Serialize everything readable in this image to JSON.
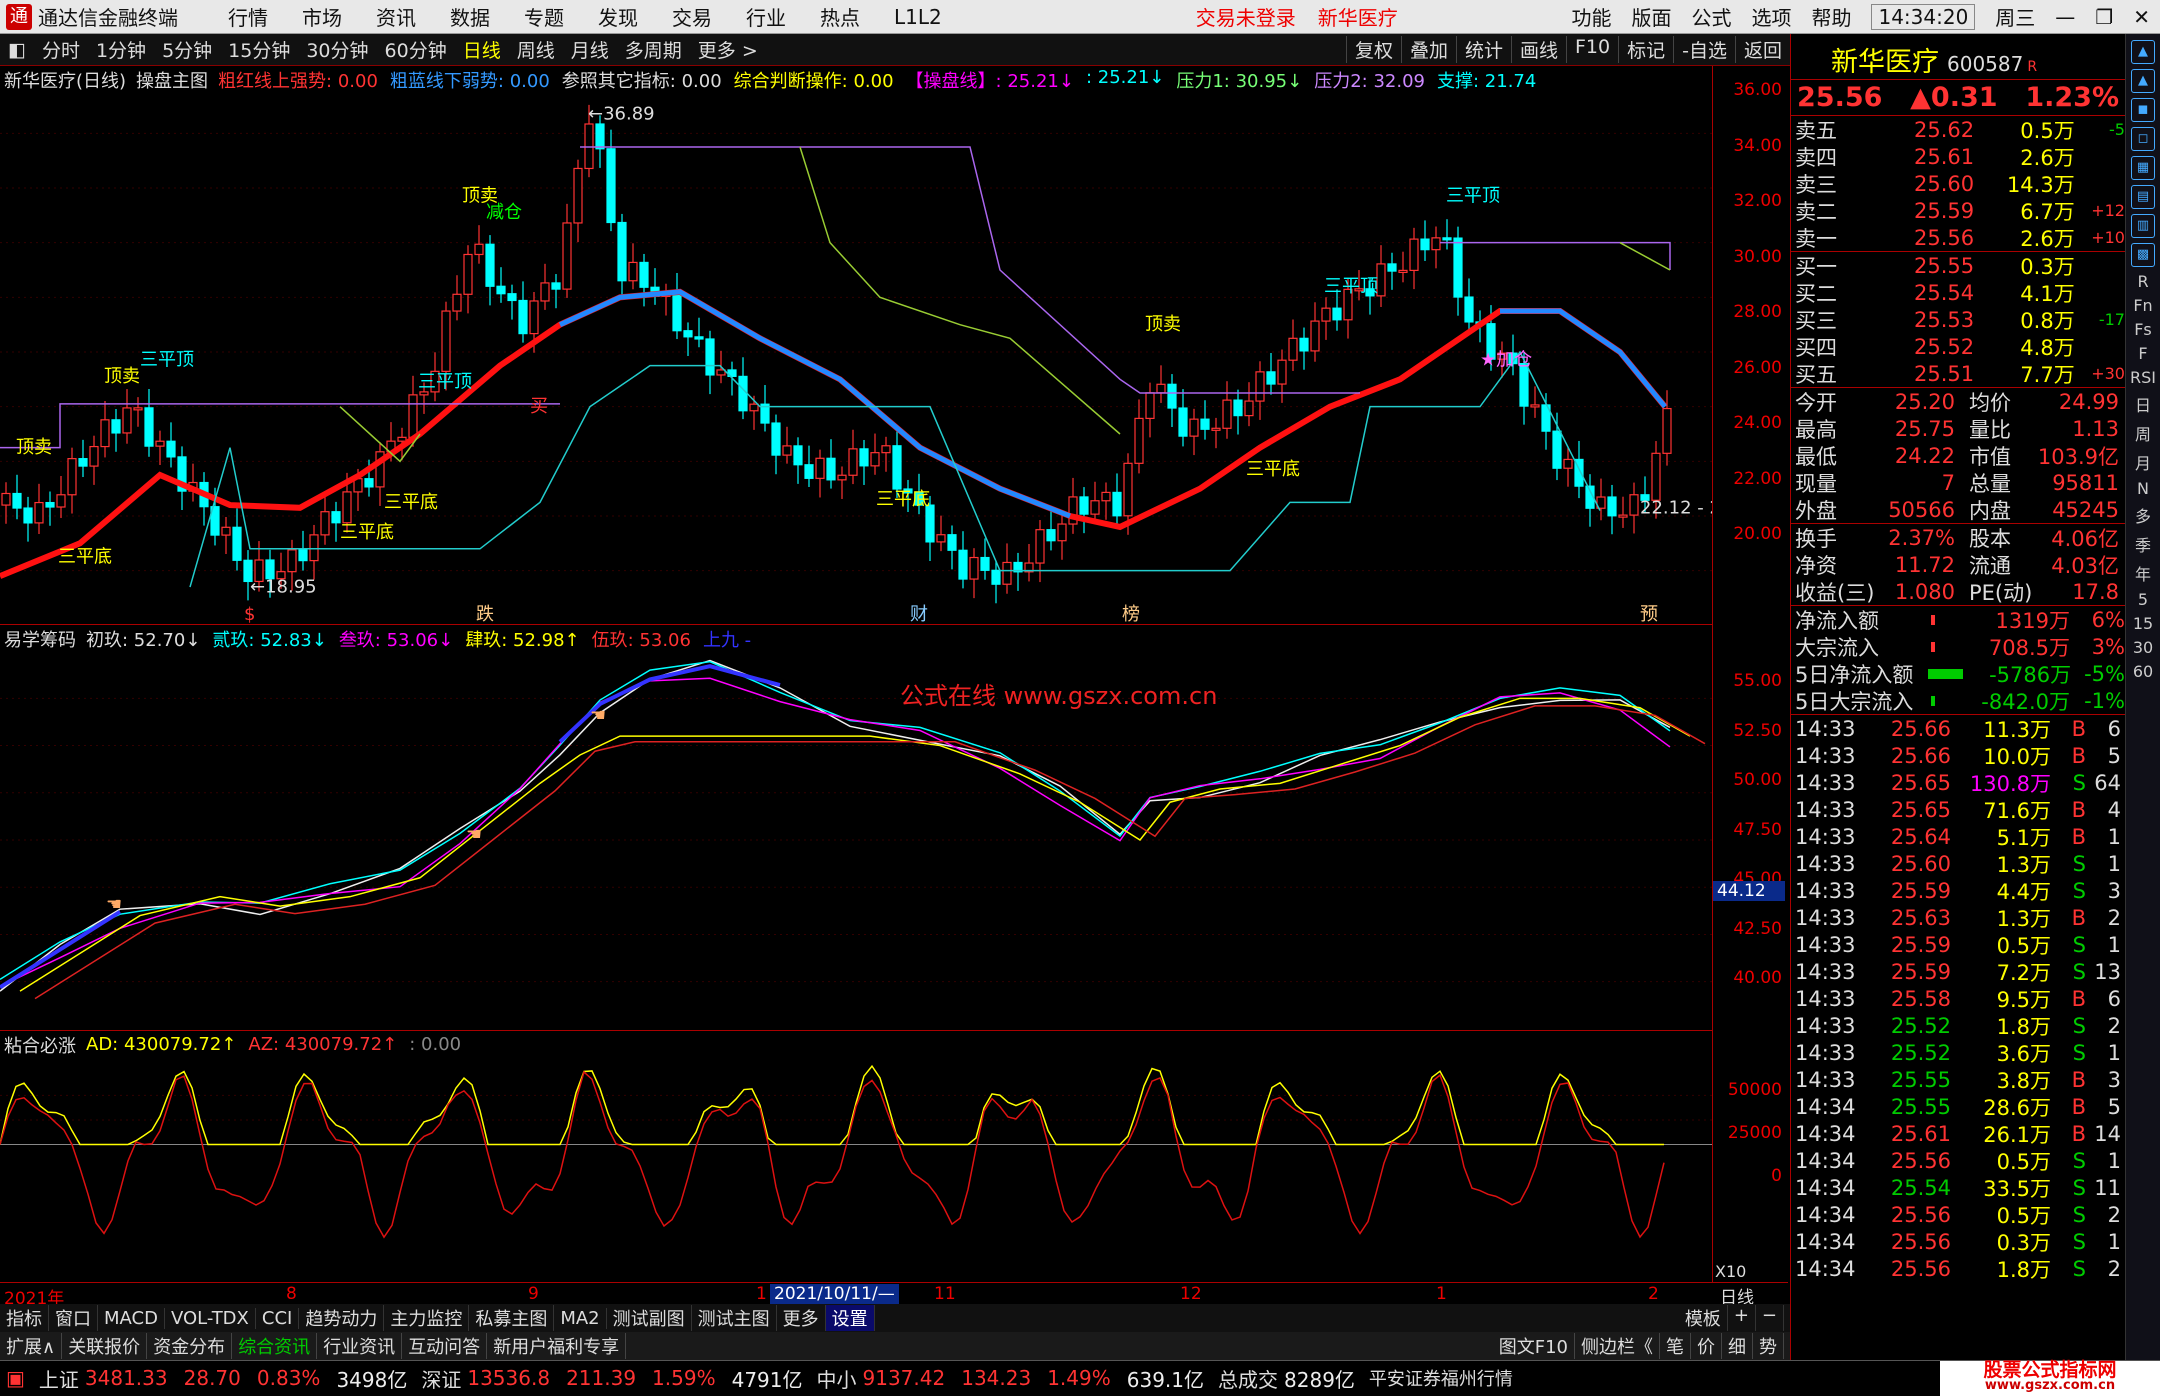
{
  "titlebar": {
    "app": "通达信金融终端",
    "menus": [
      "行情",
      "市场",
      "资讯",
      "数据",
      "专题",
      "发现",
      "交易",
      "行业",
      "热点",
      "L1L2"
    ],
    "login": "交易未登录",
    "stock_link": "新华医疗",
    "right_menus": [
      "功能",
      "版面",
      "公式",
      "选项",
      "帮助"
    ],
    "time": "14:34:20",
    "weekday": "周三"
  },
  "toolbar": {
    "periods": [
      "分时",
      "1分钟",
      "5分钟",
      "15分钟",
      "30分钟",
      "60分钟",
      "日线",
      "周线",
      "月线",
      "多周期",
      "更多 >"
    ],
    "active": "日线",
    "right": [
      "复权",
      "叠加",
      "统计",
      "画线",
      "F10",
      "标记",
      "-自选",
      "返回"
    ]
  },
  "infobar": {
    "name": "新华医疗(日线)",
    "formula": "操盘主图",
    "items": [
      {
        "t": "粗红线上强势: 0.00",
        "c": "#f33"
      },
      {
        "t": "粗蓝线下弱势: 0.00",
        "c": "#39f"
      },
      {
        "t": "参照其它指标: 0.00",
        "c": "#ddd"
      },
      {
        "t": "综合判断操作: 0.00",
        "c": "#ff0"
      },
      {
        "t": "【操盘线】: 25.21↓",
        "c": "#f0f"
      },
      {
        "t": ": 25.21↓",
        "c": "#0ff"
      },
      {
        "t": "压力1: 30.95↓",
        "c": "#7f7"
      },
      {
        "t": "压力2: 32.09",
        "c": "#c8f"
      },
      {
        "t": "支撑: 21.74",
        "c": "#0ff"
      }
    ]
  },
  "main_axis": {
    "ticks": [
      "36.00",
      "34.00",
      "32.00",
      "30.00",
      "28.00",
      "26.00",
      "24.00",
      "22.00",
      "20.00"
    ]
  },
  "annotations": {
    "high": "36.89",
    "low": "18.95",
    "last": "22.12 - 2",
    "signals": [
      "顶卖",
      "三平顶",
      "三平底",
      "减仓",
      "买",
      "加仓",
      "顶卖"
    ],
    "markers": [
      "$",
      "跌",
      "财",
      "榜",
      "预"
    ]
  },
  "ind1": {
    "title": "易学筹码",
    "items": [
      {
        "t": "初玖: 52.70↓",
        "c": "#ddd"
      },
      {
        "t": "贰玖: 52.83↓",
        "c": "#0ff"
      },
      {
        "t": "叁玖: 53.06↓",
        "c": "#f0f"
      },
      {
        "t": "肆玖: 52.98↑",
        "c": "#ff0"
      },
      {
        "t": "伍玖: 53.06",
        "c": "#f33"
      },
      {
        "t": "上九 -",
        "c": "#33f"
      }
    ],
    "watermark": "公式在线  www.gszx.com.cn",
    "ticks": [
      "55.00",
      "52.50",
      "50.00",
      "47.50",
      "45.00",
      "42.50",
      "40.00"
    ],
    "current": "44.12"
  },
  "ind2": {
    "title": "粘合必涨",
    "items": [
      {
        "t": "AD: 430079.72↑",
        "c": "#ff0"
      },
      {
        "t": "AZ: 430079.72↑",
        "c": "#f33"
      },
      {
        "t": ": 0.00",
        "c": "#888"
      }
    ],
    "ticks": [
      "50000",
      "25000",
      "0"
    ],
    "scale": "X10"
  },
  "dateaxis": {
    "labels": [
      "2021年",
      "8",
      "9",
      "1",
      "2021/10/11/—",
      "11",
      "12",
      "1",
      "2"
    ],
    "period": "日线"
  },
  "tabs": [
    "指标",
    "窗口",
    "MACD",
    "VOL-TDX",
    "CCI",
    "趋势动力",
    "主力监控",
    "私募主图",
    "MA2",
    "测试副图",
    "测试主图",
    "更多",
    "设置"
  ],
  "tabs_right": [
    "模板",
    "+",
    "−"
  ],
  "tabs2": [
    "扩展∧",
    "关联报价",
    "资金分布",
    "综合资讯",
    "行业资讯",
    "互动问答",
    "新用户福利专享"
  ],
  "tabs2_right": [
    "图文F10",
    "侧边栏《",
    "笔",
    "价",
    "细",
    "势"
  ],
  "quote": {
    "name": "新华医疗",
    "code": "600587",
    "badge": "R",
    "price": "25.56",
    "change": "▲0.31",
    "pct": "1.23%",
    "asks": [
      {
        "l": "卖五",
        "p": "25.62",
        "q": "0.5万",
        "c": "-5"
      },
      {
        "l": "卖四",
        "p": "25.61",
        "q": "2.6万",
        "c": ""
      },
      {
        "l": "卖三",
        "p": "25.60",
        "q": "14.3万",
        "c": ""
      },
      {
        "l": "卖二",
        "p": "25.59",
        "q": "6.7万",
        "c": "+12"
      },
      {
        "l": "卖一",
        "p": "25.56",
        "q": "2.6万",
        "c": "+10"
      }
    ],
    "bids": [
      {
        "l": "买一",
        "p": "25.55",
        "q": "0.3万",
        "c": ""
      },
      {
        "l": "买二",
        "p": "25.54",
        "q": "4.1万",
        "c": ""
      },
      {
        "l": "买三",
        "p": "25.53",
        "q": "0.8万",
        "c": "-17"
      },
      {
        "l": "买四",
        "p": "25.52",
        "q": "4.8万",
        "c": ""
      },
      {
        "l": "买五",
        "p": "25.51",
        "q": "7.7万",
        "c": "+30"
      }
    ],
    "stats": [
      [
        "今开",
        "25.20",
        "均价",
        "24.99"
      ],
      [
        "最高",
        "25.75",
        "量比",
        "1.13"
      ],
      [
        "最低",
        "24.22",
        "市值",
        "103.9亿"
      ],
      [
        "现量",
        "7",
        "总量",
        "95811"
      ],
      [
        "外盘",
        "50566",
        "内盘",
        "45245"
      ]
    ],
    "stats2": [
      [
        "换手",
        "2.37%",
        "股本",
        "4.06亿"
      ],
      [
        "净资",
        "11.72",
        "流通",
        "4.03亿"
      ],
      [
        "收益(三)",
        "1.080",
        "PE(动)",
        "17.8"
      ]
    ],
    "flows": [
      [
        "净流入额",
        "1319万",
        "6%"
      ],
      [
        "大宗流入",
        "708.5万",
        "3%"
      ],
      [
        "5日净流入额",
        "-5786万",
        "-5%"
      ],
      [
        "5日大宗流入",
        "-842.0万",
        "-1%"
      ]
    ],
    "ticks": [
      [
        "14:33",
        "25.66",
        "11.3万",
        "B",
        "6"
      ],
      [
        "14:33",
        "25.66",
        "10.0万",
        "B",
        "5"
      ],
      [
        "14:33",
        "25.65",
        "130.8万",
        "S",
        "64"
      ],
      [
        "14:33",
        "25.65",
        "71.6万",
        "B",
        "4"
      ],
      [
        "14:33",
        "25.64",
        "5.1万",
        "B",
        "1"
      ],
      [
        "14:33",
        "25.60",
        "1.3万",
        "S",
        "1"
      ],
      [
        "14:33",
        "25.59",
        "4.4万",
        "S",
        "3"
      ],
      [
        "14:33",
        "25.63",
        "1.3万",
        "B",
        "2"
      ],
      [
        "14:33",
        "25.59",
        "0.5万",
        "S",
        "1"
      ],
      [
        "14:33",
        "25.59",
        "7.2万",
        "S",
        "13"
      ],
      [
        "14:33",
        "25.58",
        "9.5万",
        "B",
        "6"
      ],
      [
        "14:33",
        "25.52",
        "1.8万",
        "S",
        "2"
      ],
      [
        "14:33",
        "25.52",
        "3.6万",
        "S",
        "1"
      ],
      [
        "14:33",
        "25.55",
        "3.8万",
        "B",
        "3"
      ],
      [
        "14:34",
        "25.55",
        "28.6万",
        "B",
        "5"
      ],
      [
        "14:34",
        "25.61",
        "26.1万",
        "B",
        "14"
      ],
      [
        "14:34",
        "25.56",
        "0.5万",
        "S",
        "1"
      ],
      [
        "14:34",
        "25.54",
        "33.5万",
        "S",
        "11"
      ],
      [
        "14:34",
        "25.56",
        "0.5万",
        "S",
        "2"
      ],
      [
        "14:34",
        "25.56",
        "0.3万",
        "S",
        "1"
      ],
      [
        "14:34",
        "25.56",
        "1.8万",
        "S",
        "2"
      ]
    ]
  },
  "sidebar": [
    "R",
    "Fn",
    "Fs",
    "F",
    "RSI",
    "日",
    "周",
    "月",
    "N",
    "多",
    "季",
    "年",
    "5",
    "15",
    "30",
    "60"
  ],
  "status": [
    {
      "n": "上证",
      "v": "3481.33",
      "c": "28.70",
      "p": "0.83%",
      "a": "3498亿"
    },
    {
      "n": "深证",
      "v": "13536.8",
      "c": "211.39",
      "p": "1.59%",
      "a": "4791亿"
    },
    {
      "n": "中小",
      "v": "9137.42",
      "c": "134.23",
      "p": "1.49%",
      "a": "639.1亿"
    }
  ],
  "status_extra": {
    "label": "总成交",
    "value": "8289亿",
    "broker": "平安证券福州行情"
  },
  "logo": "股票公式指标网",
  "logo_url": "www.gszx.com.cn"
}
